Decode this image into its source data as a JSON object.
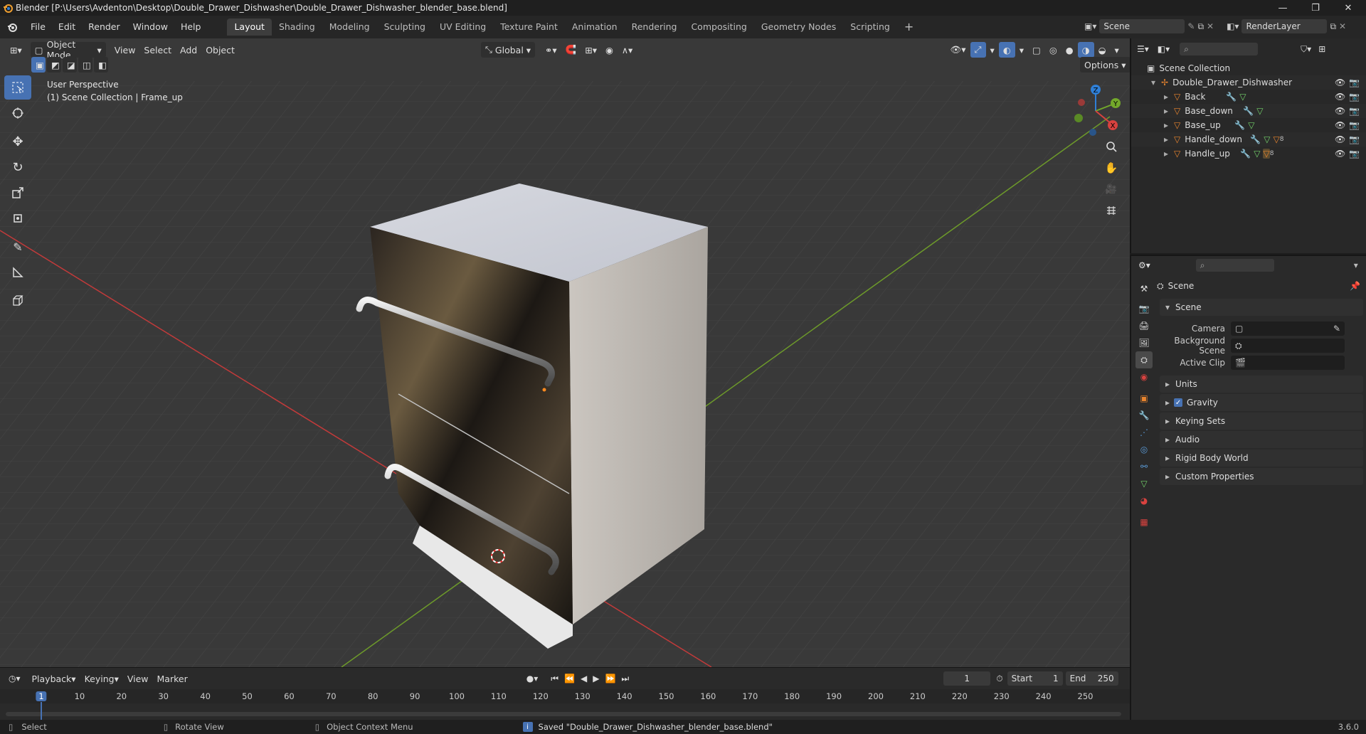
{
  "window": {
    "title": "Blender [P:\\Users\\Avdenton\\Desktop\\Double_Drawer_Dishwasher\\Double_Drawer_Dishwasher_blender_base.blend]"
  },
  "menu": [
    "File",
    "Edit",
    "Render",
    "Window",
    "Help"
  ],
  "workspaces": [
    "Layout",
    "Shading",
    "Modeling",
    "Sculpting",
    "UV Editing",
    "Texture Paint",
    "Animation",
    "Rendering",
    "Compositing",
    "Geometry Nodes",
    "Scripting"
  ],
  "active_workspace": "Layout",
  "scene_selector": {
    "scene": "Scene",
    "view_layer": "RenderLayer"
  },
  "viewport_header": {
    "mode": "Object Mode",
    "menus": [
      "View",
      "Select",
      "Add",
      "Object"
    ],
    "orientation": "Global",
    "options": "Options"
  },
  "viewport": {
    "perspective": "User Perspective",
    "collection_info": "(1) Scene Collection | Frame_up",
    "gizmo_axes": {
      "x": "X",
      "y": "Y",
      "z": "Z"
    }
  },
  "outliner": {
    "root": "Scene Collection",
    "collection": "Double_Drawer_Dishwasher",
    "objects": [
      "Back",
      "Base_down",
      "Base_up",
      "Handle_down",
      "Handle_up"
    ],
    "badge_count": "8"
  },
  "properties": {
    "context": "Scene",
    "section": "Scene",
    "camera_label": "Camera",
    "background_label": "Background Scene",
    "clip_label": "Active Clip",
    "panels": [
      "Units",
      "Gravity",
      "Keying Sets",
      "Audio",
      "Rigid Body World",
      "Custom Properties"
    ],
    "gravity_enabled": true
  },
  "timeline": {
    "menus": [
      "Playback",
      "Keying",
      "View",
      "Marker"
    ],
    "current_frame": "1",
    "start_label": "Start",
    "start": "1",
    "end_label": "End",
    "end": "250",
    "ticks": [
      "1",
      "10",
      "20",
      "30",
      "40",
      "50",
      "60",
      "70",
      "80",
      "90",
      "100",
      "110",
      "120",
      "130",
      "140",
      "150",
      "160",
      "170",
      "180",
      "190",
      "200",
      "210",
      "220",
      "230",
      "240",
      "250"
    ]
  },
  "status": {
    "select": "Select",
    "rotate": "Rotate View",
    "context_menu": "Object Context Menu",
    "message": "Saved \"Double_Drawer_Dishwasher_blender_base.blend\"",
    "version": "3.6.0"
  },
  "colors": {
    "accent": "#4772b3",
    "x_axis": "#d8423f",
    "y_axis": "#73a92b",
    "z_axis": "#2f7fd6",
    "object_icon": "#e8842e"
  }
}
